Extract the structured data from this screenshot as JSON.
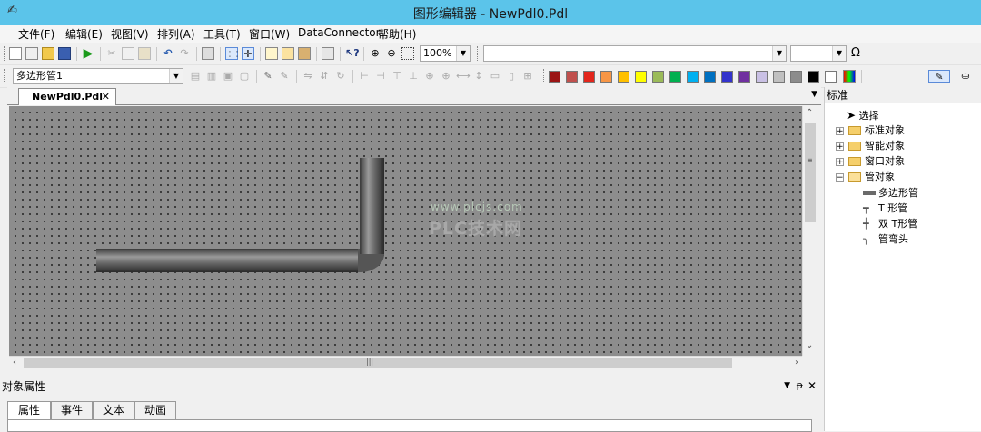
{
  "window": {
    "title": "图形编辑器 - NewPdl0.Pdl"
  },
  "menu": [
    "文件(F)",
    "编辑(E)",
    "视图(V)",
    "排列(A)",
    "工具(T)",
    "窗口(W)",
    "DataConnector",
    "帮助(H)"
  ],
  "toolbar1": {
    "zoom_value": "100%",
    "font_combo": "",
    "size_combo": "",
    "omega_label": "Ω"
  },
  "toolbar2": {
    "object_selector": "多边形管1",
    "palette": [
      "#9b1515",
      "#c0504d",
      "#e2261c",
      "#f79646",
      "#ffc000",
      "#ffff00",
      "#9bbb59",
      "#00b050",
      "#00b0f0",
      "#0070c0",
      "#3333cc",
      "#7030a0",
      "#c9c0e4",
      "#c0c0c0",
      "#8c8c8c",
      "#000000",
      "#ffffff"
    ]
  },
  "document": {
    "tab_label": "NewPdl0.Pdl",
    "close_glyph": "✕",
    "watermark_url": "www.plcjs.com",
    "watermark_text": "PLC技术网"
  },
  "colors": {
    "titlebar": "#5bc4ea",
    "canvas": "#8d8d8d",
    "grid_dots": "#2d2d2d"
  },
  "right_panel": {
    "title": "标准",
    "tree": [
      {
        "label": "选择",
        "icon": "pointer-arrow-icon",
        "indent": 0,
        "expander": ""
      },
      {
        "label": "标准对象",
        "icon": "folder-icon",
        "indent": 0,
        "expander": "+"
      },
      {
        "label": "智能对象",
        "icon": "folder-icon",
        "indent": 0,
        "expander": "+"
      },
      {
        "label": "窗口对象",
        "icon": "folder-icon",
        "indent": 0,
        "expander": "+"
      },
      {
        "label": "管对象",
        "icon": "folder-open-icon",
        "indent": 0,
        "expander": "-"
      },
      {
        "label": "多边形管",
        "icon": "pipe-straight-icon",
        "indent": 1,
        "expander": ""
      },
      {
        "label": "T 形管",
        "icon": "pipe-tee-icon",
        "indent": 1,
        "expander": ""
      },
      {
        "label": "双 T形管",
        "icon": "pipe-cross-icon",
        "indent": 1,
        "expander": ""
      },
      {
        "label": "管弯头",
        "icon": "pipe-elbow-icon",
        "indent": 1,
        "expander": ""
      }
    ]
  },
  "bottom_panel": {
    "title": "对象属性",
    "tabs": [
      "属性",
      "事件",
      "文本",
      "动画"
    ],
    "active_tab": "属性"
  }
}
